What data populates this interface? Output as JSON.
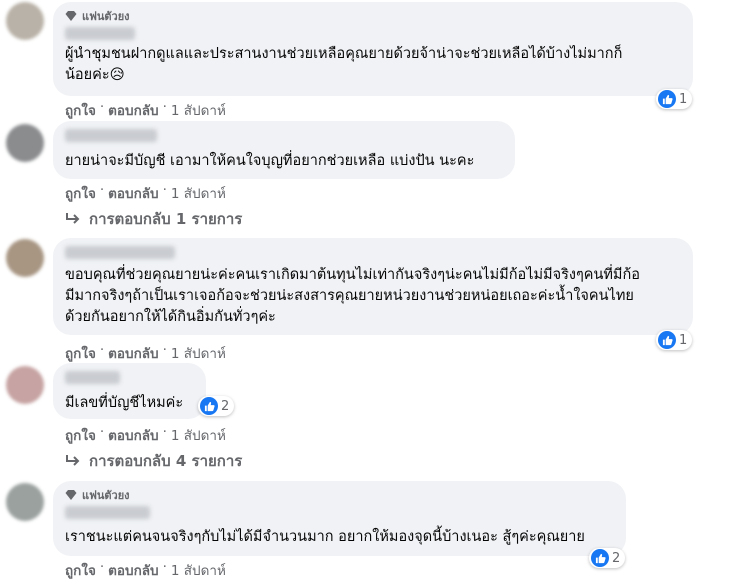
{
  "colors": {
    "bubble": "#f0f2f5",
    "like_blue": "#1877f2",
    "meta_gray": "#65676b"
  },
  "actions": {
    "like": "ถูกใจ",
    "reply": "ตอบกลับ",
    "time": "1 สัปดาห์",
    "separator": "·"
  },
  "comments": [
    {
      "badge": "แฟนตัวยง",
      "lines": [
        "ผู้นำชุมชนฝากดูแลและประสานงานช่วยเหลือคุณยายด้วยจ้าน่าจะช่วยเหลือได้บ้างไม่มากก็",
        "น้อยค่ะ😥"
      ],
      "reactions": "1"
    },
    {
      "lines": [
        "ยายน่าจะมีบัญชี เอามาให้คนใจบุญที่อยากช่วยเหลือ แบ่งปัน นะคะ"
      ],
      "replies": "การตอบกลับ 1 รายการ"
    },
    {
      "lines": [
        "ขอบคุณที่ช่วยคุณยายน่ะค่ะคนเราเกิดมาต้นทุนไม่เท่ากันจริงๆน่ะคนไม่มีก้อไม่มีจริงๆคนที่มีก้อ",
        "มีมากจริงๆถ้าเป็นเราเจอก้อจะช่วยน่ะสงสารคุณยายหน่วยงานช่วยหน่อยเถอะค่ะน้ำใจคนไทย",
        "ด้วยกันอยากให้ได้กินอิ่มกันทั่วๆค่ะ"
      ],
      "reactions": "1"
    },
    {
      "lines": [
        "มีเลขที่บัญชีไหมค่ะ"
      ],
      "reactions": "2",
      "replies": "การตอบกลับ 4 รายการ"
    },
    {
      "badge": "แฟนตัวยง",
      "lines": [
        "เราชนะแต่คนจนจริงๆกับไม่ได้มีจำนวนมาก อยากให้มองจุดนี้บ้างเนอะ สู้ๆค่ะคุณยาย"
      ],
      "reactions": "2"
    }
  ]
}
